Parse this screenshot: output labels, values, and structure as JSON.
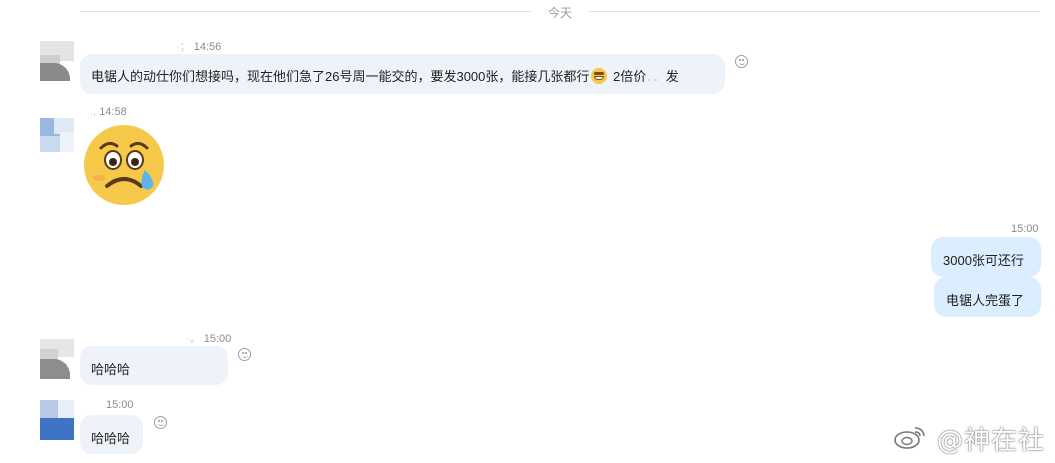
{
  "divider": {
    "label": "今天"
  },
  "messages": [
    {
      "time_prefix": "·；",
      "time": "14:56",
      "text_before": "电锯人的动仕你们想接吗，现在他们急了26号周一能交的，要发3000张，能接几张都行",
      "text_after": " 2倍价",
      "text_tail": "发"
    },
    {
      "time_prefix": ".,",
      "time": "14:58",
      "sticker": "crying-sad-face-sticker"
    },
    {
      "time": "15:00",
      "right_bubble_1": "3000张可还行",
      "right_bubble_2": "电锯人完蛋了"
    },
    {
      "time_prefix": "·。",
      "time": "15:00",
      "text": "哈哈哈"
    },
    {
      "time": "15:00",
      "text": "哈哈哈"
    }
  ],
  "watermark": {
    "text": "@神在社"
  },
  "icons": [
    "smiley-reaction-icon",
    "weibo-logo-icon",
    "grin-emoji-icon"
  ],
  "colors": {
    "bubble_left": "#eef3f9",
    "bubble_right": "#dbeeff",
    "meta": "#8c8c8c"
  }
}
